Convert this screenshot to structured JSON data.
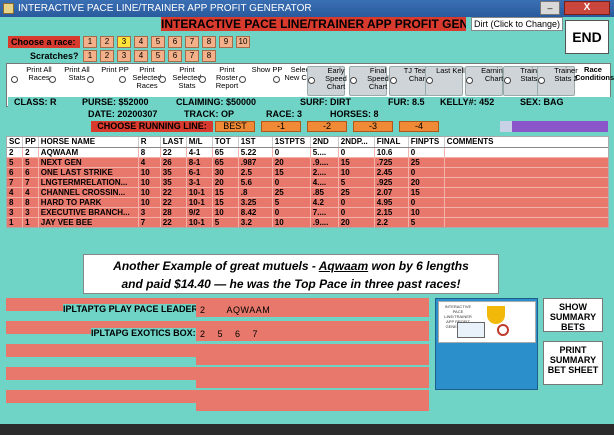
{
  "window": {
    "title": "INTERACTIVE PACE LINE/TRAINER APP PROFIT GENERATOR",
    "close_label": "X",
    "min_label": "–"
  },
  "header": {
    "banner": "INTERACTIVE PACE LINE/TRAINER APP PROFIT GENERATOR",
    "dirt_button": "Dirt (Click to Change)",
    "end_button": "END"
  },
  "race_select": {
    "choose_label": "Choose a race:",
    "scratches_label": "Scratches?",
    "race_numbers": [
      "1",
      "2",
      "3",
      "4",
      "5",
      "6",
      "7",
      "8",
      "9",
      "10"
    ],
    "selected_race": "3",
    "scratch_numbers": [
      "1",
      "2",
      "3",
      "4",
      "5",
      "6",
      "7",
      "8"
    ]
  },
  "options": [
    {
      "label": "Print All Races"
    },
    {
      "label": "Print All Stats"
    },
    {
      "label": "Print PP"
    },
    {
      "label": "Print Selected Races"
    },
    {
      "label": "Print Selected Stats"
    },
    {
      "label": "Print Roster Report"
    },
    {
      "label": "Show PP"
    },
    {
      "label": "Select New Card"
    },
    {
      "label": "Early Speed Chart"
    },
    {
      "label": "Final Speed Chart"
    },
    {
      "label": "TJ Team Chart"
    },
    {
      "label": "Last Kellyll"
    },
    {
      "label": "Earning Chart"
    },
    {
      "label": "Trainer Stats 1"
    },
    {
      "label": "Trainer Stats 2"
    },
    {
      "label": "Race Conditions"
    }
  ],
  "race_info": {
    "class": "CLASS: R",
    "purse": "PURSE: $52000",
    "claiming": "CLAIMING: $50000",
    "surf": "SURF: DIRT",
    "fur": "FUR: 8.5",
    "kelly": "KELLY#: 452",
    "sex": "SEX: BAG",
    "date": "DATE: 20200307",
    "track": "TRACK: OP",
    "race": "RACE: 3",
    "horses": "HORSES: 8"
  },
  "running_line": {
    "label": "CHOOSE RUNNING LINE:",
    "buttons": [
      "BEST",
      "-1",
      "-2",
      "-3",
      "-4"
    ]
  },
  "table": {
    "columns": [
      "SC",
      "PP",
      "HORSE NAME",
      "R",
      "LAST",
      "M/L",
      "TOT",
      "1ST",
      "1STPTS",
      "2ND",
      "2NDP...",
      "FINAL",
      "FINPTS",
      "COMMENTS"
    ],
    "rows": [
      [
        "2",
        "2",
        "AQWAAM",
        "8",
        "22",
        "4-1",
        "65",
        "5.22",
        "0",
        "5....",
        "0",
        "10.6",
        "0",
        ""
      ],
      [
        "5",
        "5",
        "NEXT GEN",
        "4",
        "26",
        "8-1",
        "65",
        ".987",
        "20",
        ".9....",
        "15",
        ".725",
        "25",
        ""
      ],
      [
        "6",
        "6",
        "ONE LAST STRIKE",
        "10",
        "35",
        "6-1",
        "30",
        "2.5",
        "15",
        "2....",
        "10",
        "2.45",
        "0",
        ""
      ],
      [
        "7",
        "7",
        "LNGTERMRELATION...",
        "10",
        "35",
        "3-1",
        "20",
        "5.6",
        "0",
        "4....",
        "5",
        ".925",
        "20",
        ""
      ],
      [
        "4",
        "4",
        "CHANNEL CROSSIN...",
        "10",
        "22",
        "10-1",
        "15",
        ".8",
        "25",
        ".85",
        "25",
        "2.07",
        "15",
        ""
      ],
      [
        "8",
        "8",
        "HARD TO PARK",
        "10",
        "22",
        "10-1",
        "15",
        "3.25",
        "5",
        "4.2",
        "0",
        "4.95",
        "0",
        ""
      ],
      [
        "3",
        "3",
        "EXECUTIVE BRANCH...",
        "3",
        "28",
        "9/2",
        "10",
        "8.42",
        "0",
        "7....",
        "0",
        "2.15",
        "10",
        ""
      ],
      [
        "1",
        "1",
        "JAY VEE BEE",
        "7",
        "22",
        "10-1",
        "5",
        "3.2",
        "10",
        ".9....",
        "20",
        "2.2",
        "5",
        ""
      ]
    ]
  },
  "callout": {
    "line1_prefix": "Another Example of great mutuels - ",
    "horse": "Aqwaam",
    "line1_suffix": " won by 6 lengths",
    "line2": "and paid $14.40 — he was the Top Pace in three past races!"
  },
  "plays": {
    "pace_leader_label": "IPLTAPTG PLAY PACE LEADER:",
    "pace_leader_num": "2",
    "pace_leader_name": "AQWAAM",
    "exotics_label": "IPLTAPG EXOTICS BOX:",
    "exotics_values": "2    5    6    7"
  },
  "logo": {
    "text": "INTERACTIVE PACE LINE/TRAINER APP PROFIT GENERATOR"
  },
  "side_buttons": {
    "summary": "SHOW SUMMARY BETS",
    "print": "PRINT SUMMARY BET SHEET"
  }
}
